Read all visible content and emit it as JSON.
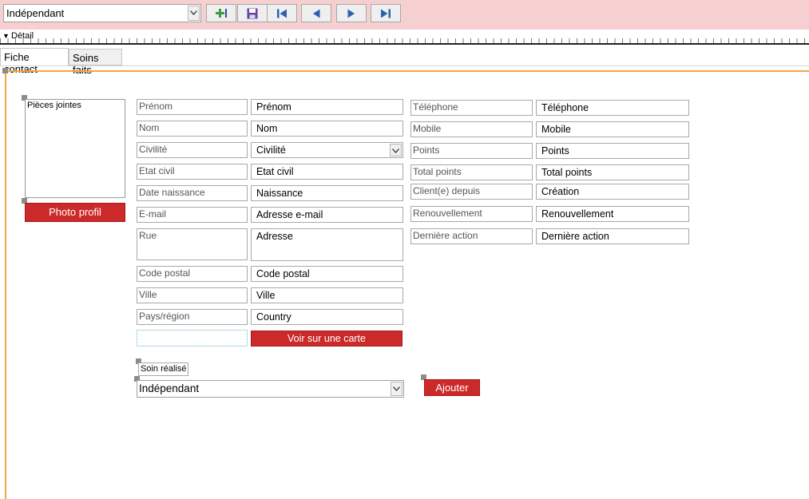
{
  "toolbar": {
    "combo_value": "Indépendant",
    "buttons": [
      {
        "name": "add-record-icon"
      },
      {
        "name": "save-icon"
      },
      {
        "name": "first-record-icon"
      },
      {
        "name": "previous-record-icon"
      },
      {
        "name": "next-record-icon"
      },
      {
        "name": "last-record-icon"
      }
    ]
  },
  "section": {
    "detail_label": "Détail"
  },
  "tabs": [
    {
      "label": "Fiche contact",
      "active": true
    },
    {
      "label": "Soins faits",
      "active": false
    }
  ],
  "form": {
    "attachments_label": "Pièces jointes",
    "photo_button": "Photo profil",
    "left_labels": {
      "prenom": "Prénom",
      "nom": "Nom",
      "civilite": "Civilité",
      "etat_civil": "Etat civil",
      "date_naissance": "Date naissance",
      "email": "E-mail",
      "rue": "Rue",
      "code_postal": "Code postal",
      "ville": "Ville",
      "pays": "Pays/région"
    },
    "left_fields": {
      "prenom": "Prénom",
      "nom": "Nom",
      "civilite": "Civilité",
      "etat_civil": "Etat civil",
      "date_naissance": "Naissance",
      "email": "Adresse e-mail",
      "rue": "Adresse",
      "code_postal": "Code postal",
      "ville": "Ville",
      "pays": "Country"
    },
    "map_button": "Voir sur une carte",
    "right_labels": {
      "telephone": "Téléphone",
      "mobile": "Mobile",
      "points": "Points",
      "total_points": "Total points",
      "client_depuis": "Client(e) depuis",
      "renouvellement": "Renouvellement",
      "derniere_action": "Dernière action"
    },
    "right_fields": {
      "telephone": "Téléphone",
      "mobile": "Mobile",
      "points": "Points",
      "total_points": "Total points",
      "client_depuis": "Création",
      "renouvellement": "Renouvellement",
      "derniere_action": "Dernière action"
    },
    "soin_label": "Soin réalisé",
    "soin_combo_value": "Indépendant",
    "add_button": "Ajouter"
  },
  "colors": {
    "toolbar_bg": "#f6d0d0",
    "accent_red": "#cc2a2a",
    "design_border": "#f4a640"
  }
}
